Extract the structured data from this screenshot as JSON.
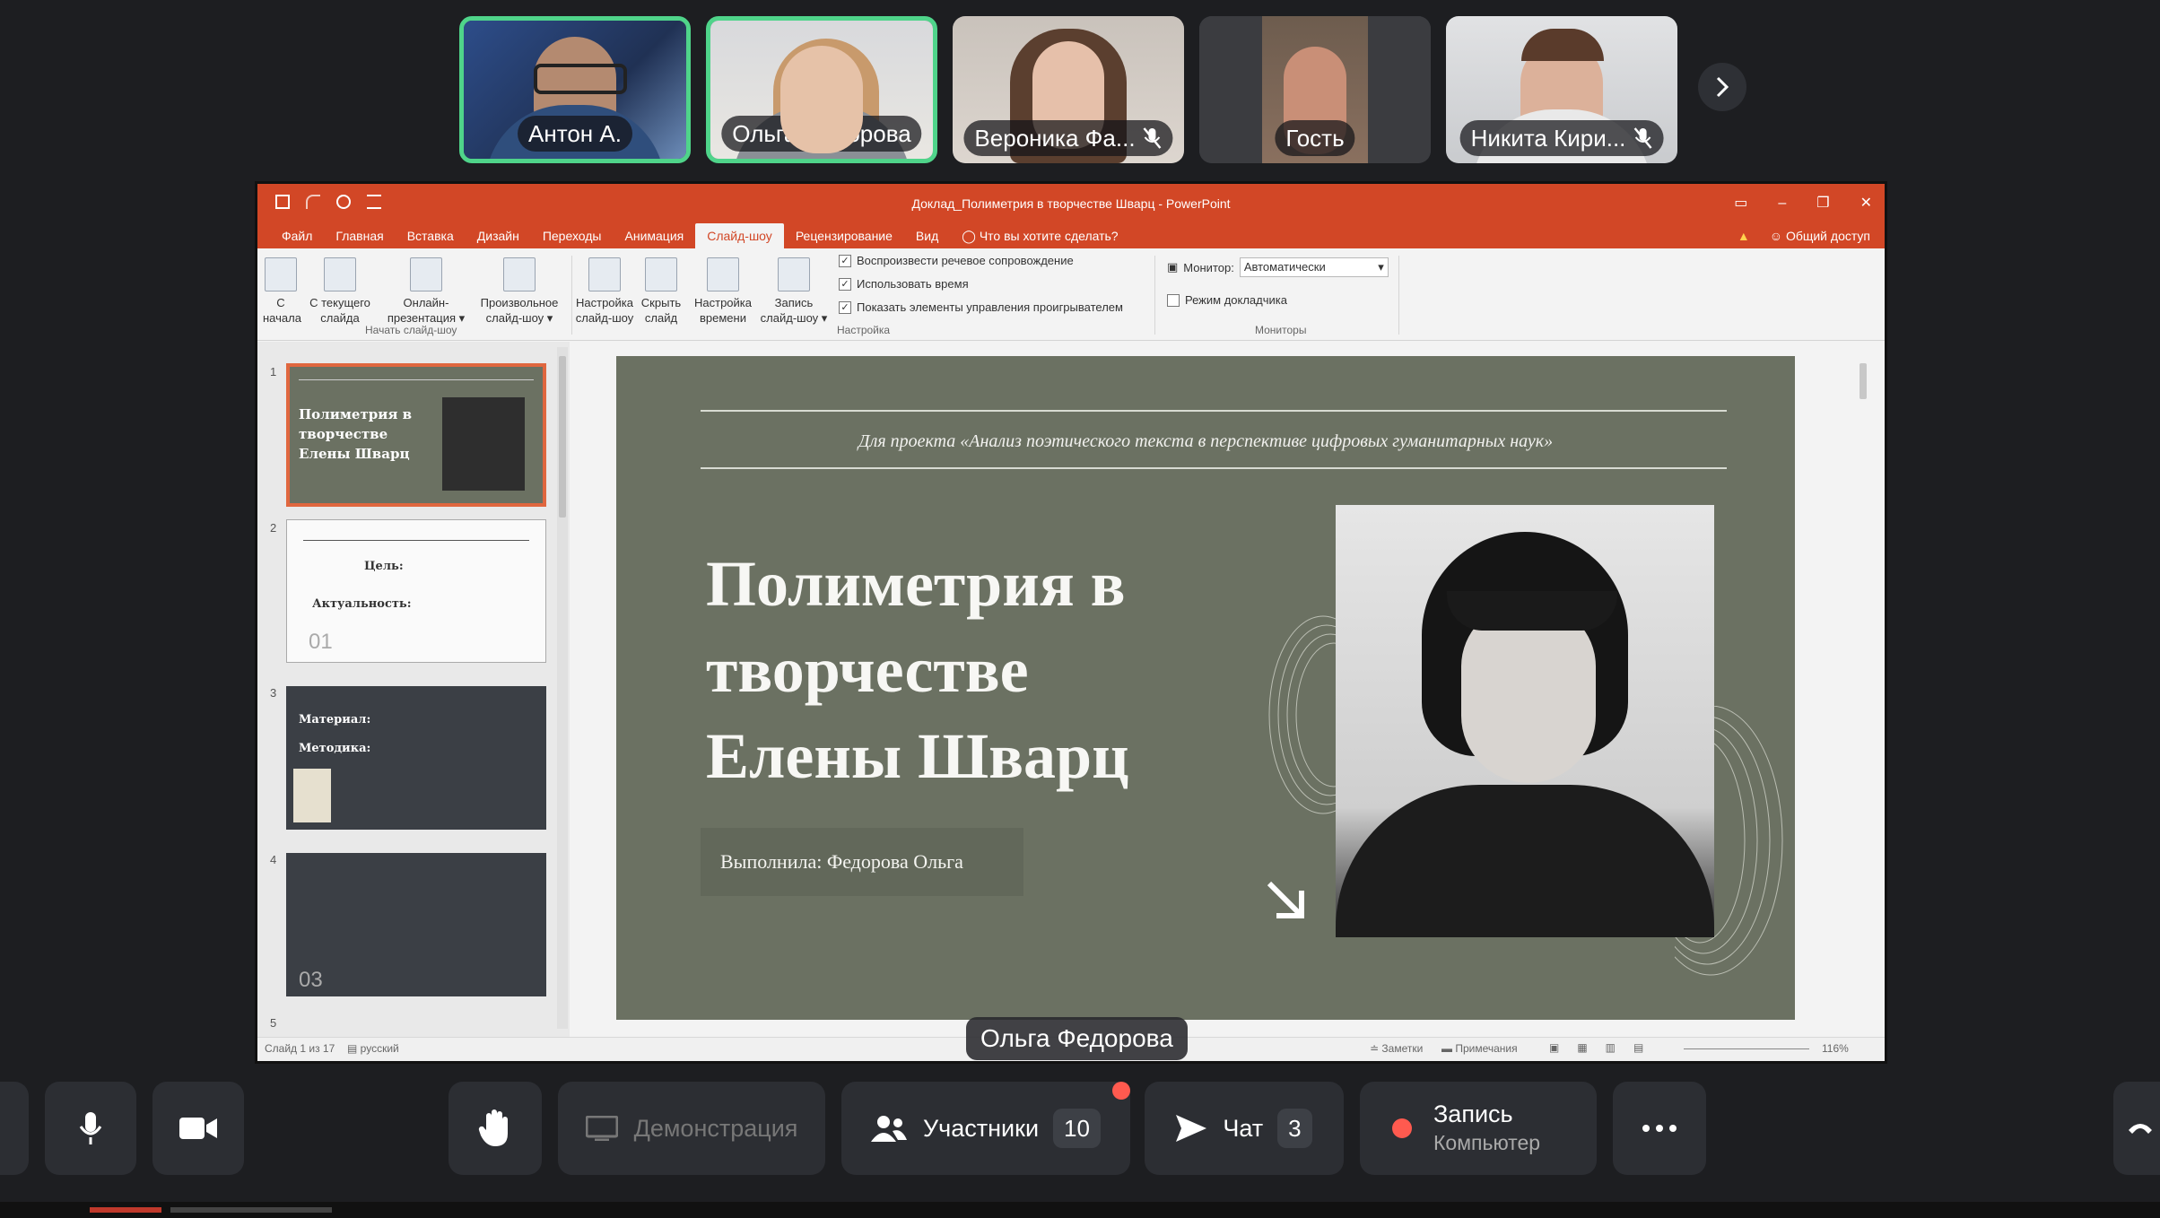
{
  "participants": [
    {
      "name": "Антон А.",
      "speaking": true,
      "muted": false
    },
    {
      "name": "Ольга Федорова",
      "speaking": true,
      "muted": false
    },
    {
      "name": "Вероника Фа...",
      "speaking": false,
      "muted": true
    },
    {
      "name": "Гость",
      "speaking": false,
      "muted": false
    },
    {
      "name": "Никита Кири...",
      "speaking": false,
      "muted": true
    }
  ],
  "ppt": {
    "window_title": "Доклад_Полиметрия в творчестве Шварц - PowerPoint",
    "tabs": [
      "Файл",
      "Главная",
      "Вставка",
      "Дизайн",
      "Переходы",
      "Анимация",
      "Слайд-шоу",
      "Рецензирование",
      "Вид"
    ],
    "active_tab": "Слайд-шоу",
    "tell_me": "Что вы хотите сделать?",
    "share": "Общий доступ",
    "ribbon": {
      "from_start": [
        "С",
        "начала"
      ],
      "from_current": [
        "С текущего",
        "слайда"
      ],
      "online": [
        "Онлайн-",
        "презентация ▾"
      ],
      "custom": [
        "Произвольное",
        "слайд-шоу ▾"
      ],
      "setup": [
        "Настройка",
        "слайд-шоу"
      ],
      "hide": [
        "Скрыть",
        "слайд"
      ],
      "rehearse": [
        "Настройка",
        "времени"
      ],
      "record": [
        "Запись",
        "слайд-шоу ▾"
      ],
      "group_start": "Начать слайд-шоу",
      "check_narration": "Воспроизвести речевое сопровождение",
      "check_timings": "Использовать время",
      "check_controls": "Показать элементы управления проигрывателем",
      "group_setup": "Настройка",
      "monitor_label": "Монитор:",
      "monitor_value": "Автоматически",
      "presenter_view": "Режим докладчика",
      "group_monitors": "Мониторы"
    },
    "thumbnails": [
      {
        "num": "1",
        "title": "Полиметрия в творчестве Елены Шварц"
      },
      {
        "num": "2",
        "labels": [
          "Цель:",
          "Актуальность:"
        ],
        "page": "01"
      },
      {
        "num": "3",
        "labels": [
          "Материал:",
          "Методика:"
        ]
      },
      {
        "num": "4",
        "page": "03"
      },
      {
        "num": "5"
      }
    ],
    "slide": {
      "subtitle": "Для проекта «Анализ поэтического текста в перспективе цифровых гуманитарных наук»",
      "title": "Полиметрия в творчестве Елены Шварц",
      "author": "Выполнила: Федорова Ольга"
    },
    "status": {
      "slide_count": "Слайд 1 из 17",
      "language": "русский",
      "notes": "Заметки",
      "comments": "Примечания",
      "zoom": "116%"
    }
  },
  "speaker_label": "Ольга Федорова",
  "controls": {
    "demo": "Демонстрация",
    "participants": "Участники",
    "participants_count": "10",
    "chat": "Чат",
    "chat_count": "3",
    "record": "Запись",
    "record_sub": "Компьютер"
  },
  "colors": {
    "accent": "#d24726",
    "speaking_border": "#4fd48a",
    "slide_bg": "#6b7162",
    "record": "#ff5a4f"
  }
}
